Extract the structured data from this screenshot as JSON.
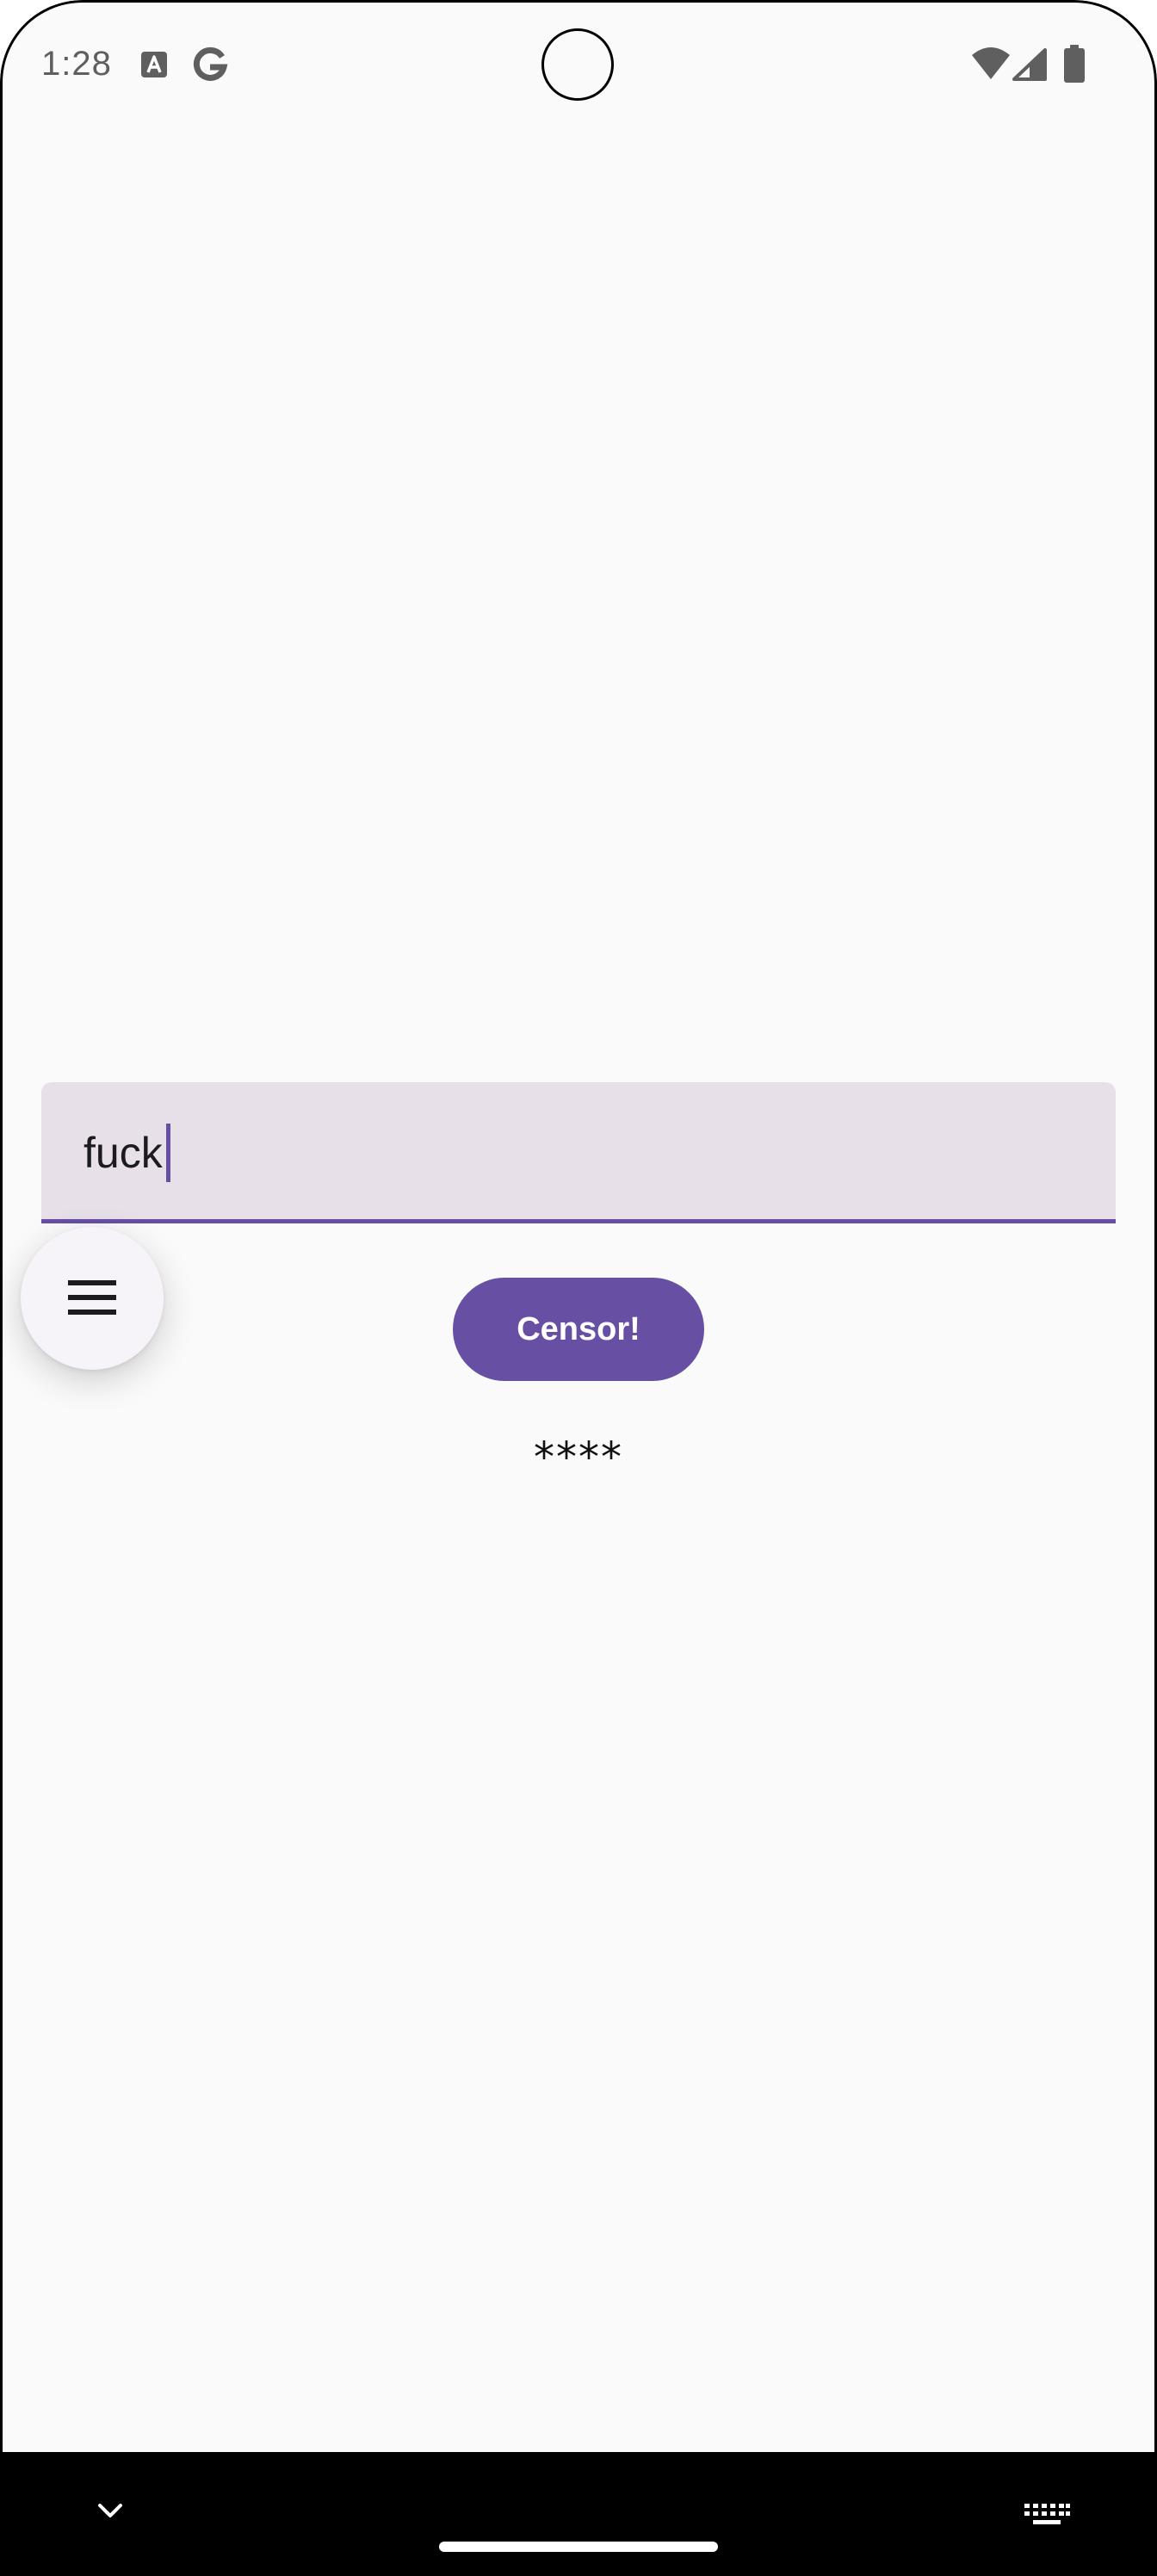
{
  "status_bar": {
    "time": "1:28",
    "icons": [
      "text-a-icon",
      "google-g-icon",
      "wifi-icon",
      "signal-icon",
      "battery-icon"
    ]
  },
  "text_field": {
    "value": "fuck"
  },
  "fab": {
    "icon": "menu-icon"
  },
  "censor_button": {
    "label": "Censor!"
  },
  "result": {
    "text": "****"
  },
  "nav_bar": {
    "icons": [
      "chevron-down-icon",
      "home-handle",
      "keyboard-icon"
    ]
  },
  "colors": {
    "accent": "#6750a4",
    "field_background": "#e7e0e8",
    "background": "#fafafa",
    "fab_background": "#f6f3f9"
  }
}
